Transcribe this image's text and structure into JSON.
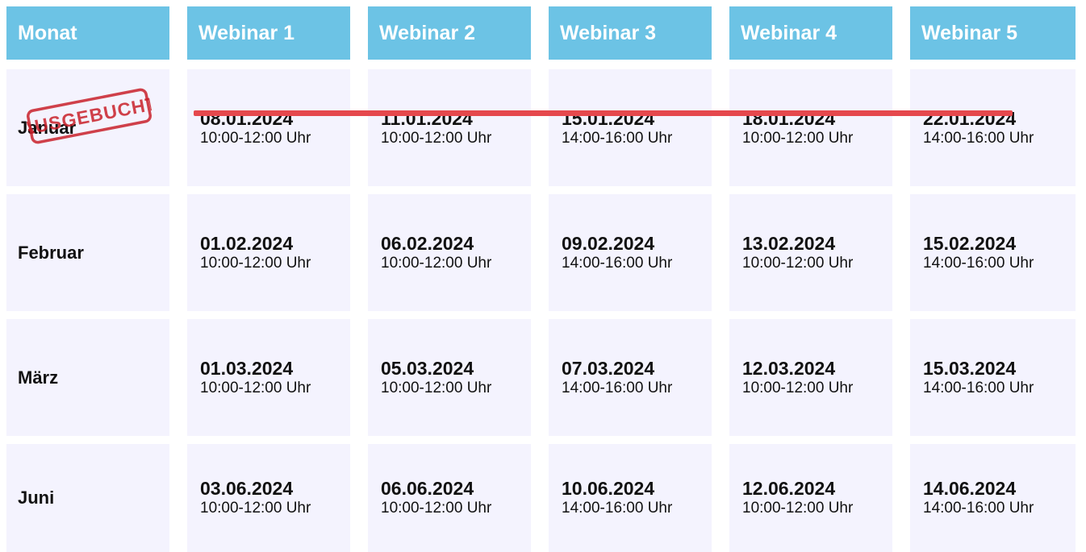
{
  "header": [
    "Monat",
    "Webinar 1",
    "Webinar 2",
    "Webinar 3",
    "Webinar 4",
    "Webinar 5"
  ],
  "rows": [
    {
      "month": "Januar",
      "sold_out": true,
      "stamp_text": "AUSGEBUCHT",
      "webinars": [
        {
          "date": "08.01.2024",
          "time": "10:00-12:00 Uhr"
        },
        {
          "date": "11.01.2024",
          "time": "10:00-12:00 Uhr"
        },
        {
          "date": "15.01.2024",
          "time": "14:00-16:00 Uhr"
        },
        {
          "date": "18.01.2024",
          "time": "10:00-12:00 Uhr"
        },
        {
          "date": "22.01.2024",
          "time": "14:00-16:00 Uhr"
        }
      ]
    },
    {
      "month": "Februar",
      "sold_out": false,
      "webinars": [
        {
          "date": "01.02.2024",
          "time": "10:00-12:00 Uhr"
        },
        {
          "date": "06.02.2024",
          "time": "10:00-12:00 Uhr"
        },
        {
          "date": "09.02.2024",
          "time": "14:00-16:00 Uhr"
        },
        {
          "date": "13.02.2024",
          "time": "10:00-12:00 Uhr"
        },
        {
          "date": "15.02.2024",
          "time": "14:00-16:00 Uhr"
        }
      ]
    },
    {
      "month": "März",
      "sold_out": false,
      "webinars": [
        {
          "date": "01.03.2024",
          "time": "10:00-12:00 Uhr"
        },
        {
          "date": "05.03.2024",
          "time": "10:00-12:00 Uhr"
        },
        {
          "date": "07.03.2024",
          "time": "14:00-16:00 Uhr"
        },
        {
          "date": "12.03.2024",
          "time": "10:00-12:00 Uhr"
        },
        {
          "date": "15.03.2024",
          "time": "14:00-16:00 Uhr"
        }
      ]
    },
    {
      "month": "Juni",
      "sold_out": false,
      "webinars": [
        {
          "date": "03.06.2024",
          "time": "10:00-12:00 Uhr"
        },
        {
          "date": "06.06.2024",
          "time": "10:00-12:00 Uhr"
        },
        {
          "date": "10.06.2024",
          "time": "14:00-16:00 Uhr"
        },
        {
          "date": "12.06.2024",
          "time": "10:00-12:00 Uhr"
        },
        {
          "date": "14.06.2024",
          "time": "14:00-16:00 Uhr"
        }
      ]
    }
  ],
  "colors": {
    "header_bg": "#6cc3e5",
    "cell_bg": "#f4f3fe",
    "strike": "#e5484d",
    "stamp": "#c8202a"
  }
}
